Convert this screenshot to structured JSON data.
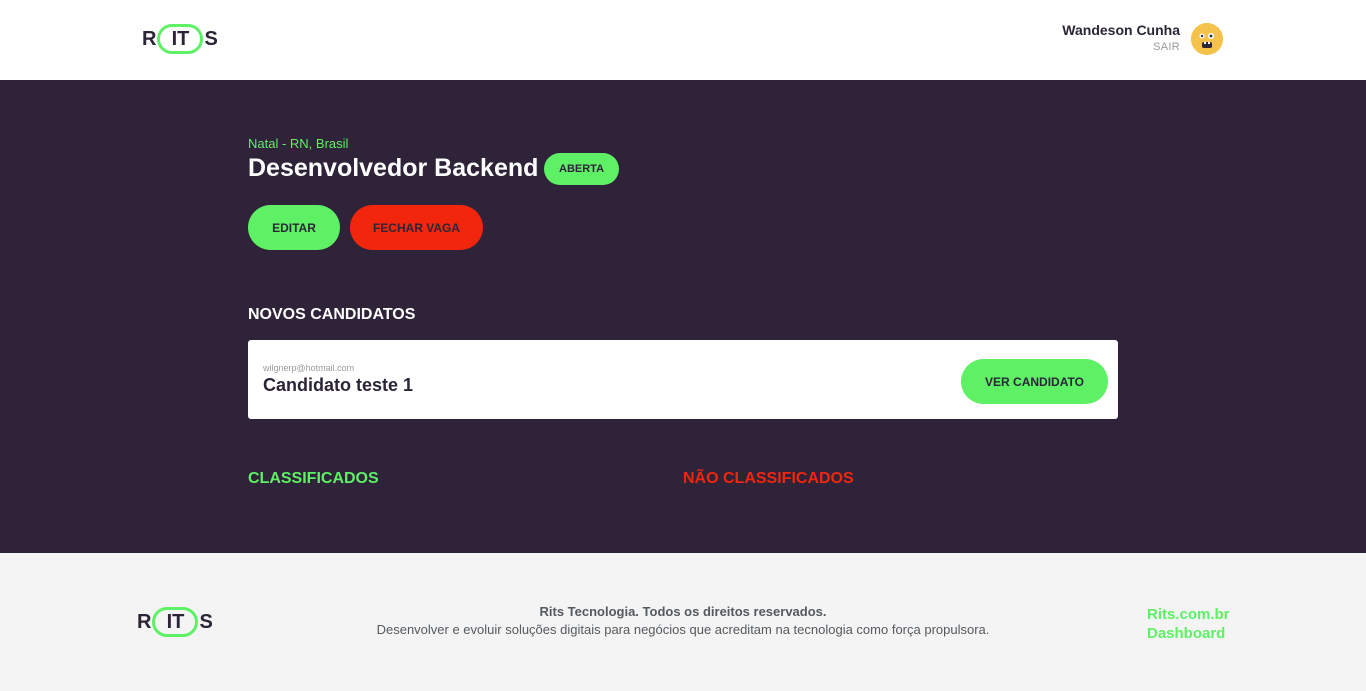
{
  "header": {
    "logo": {
      "left": "R",
      "middle": "IT",
      "right": "S"
    },
    "user": {
      "name": "Wandeson Cunha",
      "logout_label": "SAIR",
      "avatar_icon": "emoji-avatar-icon"
    }
  },
  "job": {
    "location": "Natal - RN, Brasil",
    "title": "Desenvolvedor Backend",
    "status": "ABERTA",
    "edit_label": "EDITAR",
    "close_label": "FECHAR VAGA"
  },
  "new_candidates": {
    "title": "NOVOS CANDIDATOS",
    "items": [
      {
        "email": "wilgnerp@hotmail.com",
        "name": "Candidato teste 1",
        "action_label": "VER CANDIDATO"
      }
    ]
  },
  "classified": {
    "title": "CLASSIFICADOS"
  },
  "unclassified": {
    "title": "NÃO CLASSIFICADOS"
  },
  "footer": {
    "logo": {
      "left": "R",
      "middle": "IT",
      "right": "S"
    },
    "copyright": "Rits Tecnologia. Todos os direitos reservados.",
    "description": "Desenvolver e evoluir soluções digitais para negócios que acreditam na tecnologia como força propulsora.",
    "links": [
      "Rits.com.br",
      "Dashboard"
    ]
  },
  "colors": {
    "accent_green": "#5ef065",
    "danger_red": "#f1260d",
    "dark_bg": "#2e2338",
    "text_dark": "#2c2538"
  }
}
